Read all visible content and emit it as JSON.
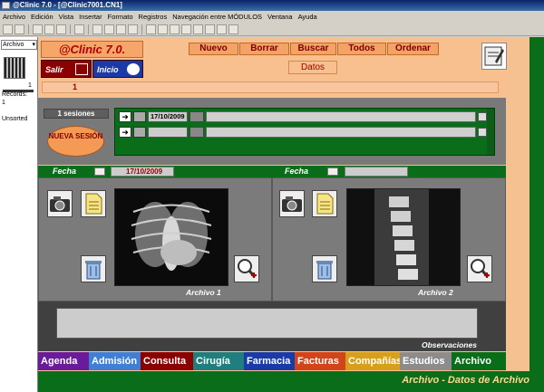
{
  "window": {
    "title": "@Clinic 7.0 - [@Clinic7001.CN1]"
  },
  "menu": [
    "Archivo",
    "Edición",
    "Vista",
    "Insertar",
    "Formato",
    "Registros",
    "Navegación entre MÓDULOS",
    "Ventana",
    "Ayuda"
  ],
  "left_pane": {
    "select": "Archivo",
    "counter": "1",
    "records_label": "Records:",
    "records_value": "1",
    "sort_label": "Unsorted"
  },
  "header": {
    "logo": "@Clinic 7.0.",
    "salir": "Salir",
    "inicio": "Inicio",
    "buttons": {
      "nuevo": "Nuevo",
      "borrar": "Borrar",
      "buscar": "Buscar",
      "todos": "Todos",
      "ordenar": "Ordenar"
    },
    "datos": "Datos",
    "record_number": "1"
  },
  "sessions": {
    "count": "1 sesiones",
    "new_session": "NUEVA SESIÓN",
    "rows": [
      {
        "date": "17/10/2009"
      },
      {
        "date": ""
      }
    ]
  },
  "archives": [
    {
      "fecha_label": "Fecha",
      "fecha": "17/10/2009",
      "caption": "Archivo 1",
      "image": "chest-xray"
    },
    {
      "fecha_label": "Fecha",
      "fecha": "",
      "caption": "Archivo 2",
      "image": "spine-xray"
    }
  ],
  "observaciones_label": "Observaciones",
  "tabs": [
    {
      "label": "Agenda",
      "color": "#6a1b9a"
    },
    {
      "label": "Admisión",
      "color": "#3f7fd6"
    },
    {
      "label": "Consulta",
      "color": "#8b0000"
    },
    {
      "label": "Cirugía",
      "color": "#1f7f7f"
    },
    {
      "label": "Farmacia",
      "color": "#1a3aa8"
    },
    {
      "label": "Facturas",
      "color": "#d2441a"
    },
    {
      "label": "Compañías",
      "color": "#d8a01a"
    },
    {
      "label": "Estudios",
      "color": "#8c8c8c"
    },
    {
      "label": "Archivo",
      "color": "#0a6d1a"
    }
  ],
  "status": "Archivo - Datos de Archivo"
}
